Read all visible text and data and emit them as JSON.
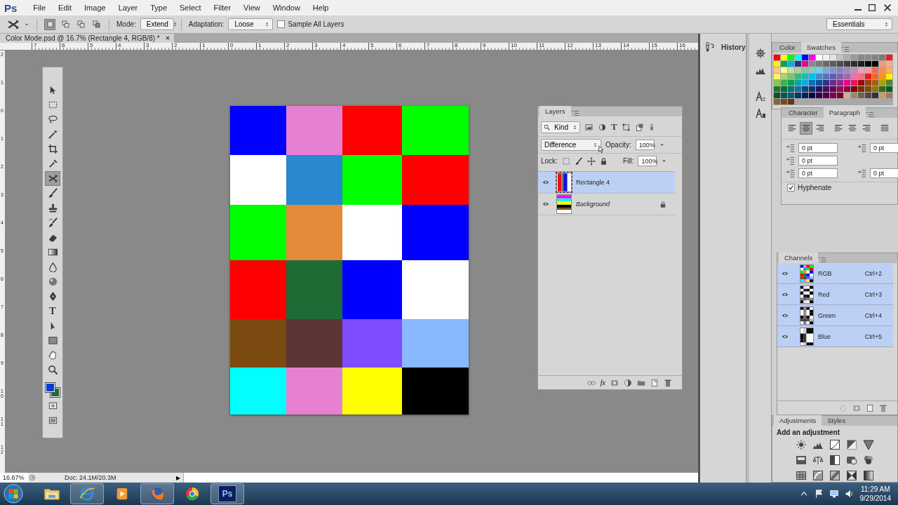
{
  "app_logo": "Ps",
  "menu": [
    "File",
    "Edit",
    "Image",
    "Layer",
    "Type",
    "Select",
    "Filter",
    "View",
    "Window",
    "Help"
  ],
  "options_bar": {
    "selection_modes": [
      {
        "selected": true
      },
      {
        "selected": false
      },
      {
        "selected": false
      },
      {
        "selected": false
      }
    ],
    "mode_label": "Mode:",
    "mode_value": "Extend",
    "adaptation_label": "Adaptation:",
    "adaptation_value": "Loose",
    "sample_all_layers": {
      "label": "Sample All Layers",
      "checked": false
    },
    "workspace": "Essentials"
  },
  "document_tab": {
    "title": "Color Mode.psd @ 16.7% (Rectangle 4, RGB/8) *",
    "close": "×"
  },
  "ruler_h": [
    "7",
    "6",
    "5",
    "4",
    "3",
    "2",
    "1",
    "0",
    "1",
    "2",
    "3",
    "4",
    "5",
    "6",
    "7",
    "8",
    "9",
    "10",
    "11",
    "12",
    "13",
    "14",
    "15",
    "16"
  ],
  "ruler_v": [
    "2",
    "1",
    "0",
    "1",
    "2",
    "3",
    "4",
    "5",
    "6",
    "7",
    "8",
    "9",
    "10",
    "11",
    "12"
  ],
  "tools": [
    {
      "selected": false
    },
    {
      "selected": false
    },
    {
      "selected": false
    },
    {
      "selected": false
    },
    {
      "selected": false
    },
    {
      "selected": false
    },
    {
      "selected": true
    },
    {
      "selected": false
    },
    {
      "selected": false
    },
    {
      "selected": false
    },
    {
      "selected": false
    },
    {
      "selected": false
    },
    {
      "selected": false
    },
    {
      "selected": false
    },
    {
      "selected": false
    },
    {
      "selected": false,
      "glyph": "T"
    },
    {
      "selected": false
    },
    {
      "selected": false
    },
    {
      "selected": false
    },
    {
      "selected": false
    }
  ],
  "color_chips": [
    {
      "kind": "foreground",
      "color": "#0c3bd0"
    },
    {
      "kind": "background",
      "color": "#1f6b36"
    }
  ],
  "canvas": {
    "rows": [
      {
        "cells": [
          {
            "color": "#0000ff"
          },
          {
            "color": "#e680d2"
          },
          {
            "color": "#ff0000"
          },
          {
            "color": "#00ff00"
          }
        ]
      },
      {
        "cells": [
          {
            "color": "#ffffff"
          },
          {
            "color": "#2a88d0"
          },
          {
            "color": "#00ff00"
          },
          {
            "color": "#ff0000"
          }
        ]
      },
      {
        "cells": [
          {
            "color": "#00ff00"
          },
          {
            "color": "#e58a3a"
          },
          {
            "color": "#ffffff"
          },
          {
            "color": "#0000ff"
          }
        ]
      },
      {
        "cells": [
          {
            "color": "#ff0000"
          },
          {
            "color": "#1f6b36"
          },
          {
            "color": "#0000ff"
          },
          {
            "color": "#ffffff"
          }
        ]
      },
      {
        "cells": [
          {
            "color": "#7a4a10"
          },
          {
            "color": "#5e3535"
          },
          {
            "color": "#7f4cff"
          },
          {
            "color": "#8ab8ff"
          }
        ]
      },
      {
        "cells": [
          {
            "color": "#00ffff"
          },
          {
            "color": "#e680d2"
          },
          {
            "color": "#ffff00"
          },
          {
            "color": "#000000"
          }
        ]
      }
    ]
  },
  "layers_panel": {
    "tab": "Layers",
    "filter": "Kind",
    "type_filter": "T",
    "blend_mode": "Difference",
    "opacity_label": "Opacity:",
    "opacity": "100%",
    "lock_label": "Lock:",
    "fill_label": "Fill:",
    "fill": "100%",
    "fx": "fx",
    "layers": [
      {
        "name": "Rectangle 4",
        "kind": "shape",
        "selected": true,
        "visible": true,
        "locked": false
      },
      {
        "name": "Background",
        "kind": "background",
        "selected": false,
        "visible": true,
        "locked": true
      }
    ]
  },
  "history_dock": {
    "label": "History"
  },
  "swatches_panel": {
    "tabs": [
      {
        "label": "Color",
        "selected": false
      },
      {
        "label": "Swatches",
        "selected": true
      }
    ],
    "swatches": [
      {
        "color": "#ff0000"
      },
      {
        "color": "#ffff00"
      },
      {
        "color": "#00ff00"
      },
      {
        "color": "#00ffff"
      },
      {
        "color": "#0000ff"
      },
      {
        "color": "#ff00ff"
      },
      {
        "color": "#ffffff"
      },
      {
        "color": "#f2f2f2"
      },
      {
        "color": "#e4e4e4"
      },
      {
        "color": "#c3c3c3"
      },
      {
        "color": "#afafaf"
      },
      {
        "color": "#9b9b9b"
      },
      {
        "color": "#878787"
      },
      {
        "color": "#8c8c8c"
      },
      {
        "color": "#828282"
      },
      {
        "color": "#7a7a7a"
      },
      {
        "color": "#ed1c24"
      },
      {
        "color": "#fff200"
      },
      {
        "color": "#00a651"
      },
      {
        "color": "#00aeef"
      },
      {
        "color": "#2e3192"
      },
      {
        "color": "#ec008c"
      },
      {
        "color": "#898989"
      },
      {
        "color": "#7a7a7a"
      },
      {
        "color": "#6b6b6b"
      },
      {
        "color": "#5c5c5c"
      },
      {
        "color": "#4d4d4d"
      },
      {
        "color": "#3e3e3e"
      },
      {
        "color": "#2f2f2f"
      },
      {
        "color": "#1f1f1f"
      },
      {
        "color": "#0a0a0a"
      },
      {
        "color": "#000000"
      },
      {
        "color": "#f7977a"
      },
      {
        "color": "#fbad82"
      },
      {
        "color": "#fdc68a"
      },
      {
        "color": "#fff79a"
      },
      {
        "color": "#c4df9b"
      },
      {
        "color": "#a3d39c"
      },
      {
        "color": "#82ca9d"
      },
      {
        "color": "#7bcdc8"
      },
      {
        "color": "#6ecff6"
      },
      {
        "color": "#7ea7d8"
      },
      {
        "color": "#8493ca"
      },
      {
        "color": "#8882be"
      },
      {
        "color": "#a187be"
      },
      {
        "color": "#bc8dbf"
      },
      {
        "color": "#f49ac2"
      },
      {
        "color": "#f6989d"
      },
      {
        "color": "#f26c4f"
      },
      {
        "color": "#f68e55"
      },
      {
        "color": "#fbaf5c"
      },
      {
        "color": "#fff467"
      },
      {
        "color": "#acd372"
      },
      {
        "color": "#7cc576"
      },
      {
        "color": "#3bb878"
      },
      {
        "color": "#1abbb4"
      },
      {
        "color": "#00bff3"
      },
      {
        "color": "#438ccb"
      },
      {
        "color": "#5574b9"
      },
      {
        "color": "#605ca8"
      },
      {
        "color": "#855fa8"
      },
      {
        "color": "#a763a8"
      },
      {
        "color": "#f06eaa"
      },
      {
        "color": "#f26d7d"
      },
      {
        "color": "#ed1c24"
      },
      {
        "color": "#f26522"
      },
      {
        "color": "#f7941d"
      },
      {
        "color": "#fff200"
      },
      {
        "color": "#8dc73f"
      },
      {
        "color": "#39b54a"
      },
      {
        "color": "#00a651"
      },
      {
        "color": "#00a99d"
      },
      {
        "color": "#00aeef"
      },
      {
        "color": "#0072bc"
      },
      {
        "color": "#0054a6"
      },
      {
        "color": "#2e3192"
      },
      {
        "color": "#662d91"
      },
      {
        "color": "#92278f"
      },
      {
        "color": "#ec008c"
      },
      {
        "color": "#ed145b"
      },
      {
        "color": "#9e0b0f"
      },
      {
        "color": "#a0410d"
      },
      {
        "color": "#a36209"
      },
      {
        "color": "#aba000"
      },
      {
        "color": "#598527"
      },
      {
        "color": "#197b30"
      },
      {
        "color": "#007236"
      },
      {
        "color": "#00746b"
      },
      {
        "color": "#0076a3"
      },
      {
        "color": "#004a80"
      },
      {
        "color": "#003471"
      },
      {
        "color": "#1b1464"
      },
      {
        "color": "#440e62"
      },
      {
        "color": "#630460"
      },
      {
        "color": "#9e005d"
      },
      {
        "color": "#9e0039"
      },
      {
        "color": "#790000"
      },
      {
        "color": "#7b2e00"
      },
      {
        "color": "#7d4900"
      },
      {
        "color": "#827b00"
      },
      {
        "color": "#406618"
      },
      {
        "color": "#005e20"
      },
      {
        "color": "#005826"
      },
      {
        "color": "#005952"
      },
      {
        "color": "#005b7f"
      },
      {
        "color": "#003663"
      },
      {
        "color": "#002157"
      },
      {
        "color": "#0d004c"
      },
      {
        "color": "#32004b"
      },
      {
        "color": "#4b0049"
      },
      {
        "color": "#7b0046"
      },
      {
        "color": "#7a0026"
      },
      {
        "color": "#c7b299"
      },
      {
        "color": "#998675"
      },
      {
        "color": "#736357"
      },
      {
        "color": "#534741"
      },
      {
        "color": "#37302a"
      },
      {
        "color": "#c69c6d"
      },
      {
        "color": "#a67c52"
      },
      {
        "color": "#8c6239"
      },
      {
        "color": "#754c24"
      },
      {
        "color": "#603913"
      }
    ]
  },
  "paragraph_panel": {
    "tabs": [
      {
        "label": "Character",
        "selected": false
      },
      {
        "label": "Paragraph",
        "selected": true
      }
    ],
    "alignments": [
      {
        "selected": false
      },
      {
        "selected": true
      },
      {
        "selected": false
      },
      {
        "selected": false
      },
      {
        "selected": false
      },
      {
        "selected": false
      },
      {
        "selected": false
      }
    ],
    "fields": [
      {
        "value": "0 pt"
      },
      {
        "value": "0 pt"
      },
      {
        "value": "0 pt"
      },
      {
        "value": "0 pt"
      },
      {
        "value": "0 pt"
      }
    ],
    "hyphenate": {
      "label": "Hyphenate",
      "checked": true
    }
  },
  "channels_panel": {
    "tab": "Channels",
    "channels": [
      {
        "name": "RGB",
        "shortcut": "Ctrl+2",
        "kind": "composite",
        "selected": true,
        "visible": true
      },
      {
        "name": "Red",
        "shortcut": "Ctrl+3",
        "kind": "red",
        "selected": true,
        "visible": true
      },
      {
        "name": "Green",
        "shortcut": "Ctrl+4",
        "kind": "green",
        "selected": true,
        "visible": true
      },
      {
        "name": "Blue",
        "shortcut": "Ctrl+5",
        "kind": "blue",
        "selected": true,
        "visible": true
      }
    ]
  },
  "adjustments_panel": {
    "tabs": [
      {
        "label": "Adjustments",
        "selected": true
      },
      {
        "label": "Styles",
        "selected": false
      }
    ],
    "heading": "Add an adjustment"
  },
  "status_bar": {
    "zoom": "16.67%",
    "doc_info": "Doc: 24.1M/20.3M",
    "arrow": "▶"
  },
  "taskbar": {
    "apps": [
      {
        "open": false
      },
      {
        "open": true
      },
      {
        "open": false
      },
      {
        "open": true
      },
      {
        "open": false
      },
      {
        "open": true,
        "label": "Ps"
      }
    ],
    "time": "11:29 AM",
    "date": "9/29/2014"
  }
}
